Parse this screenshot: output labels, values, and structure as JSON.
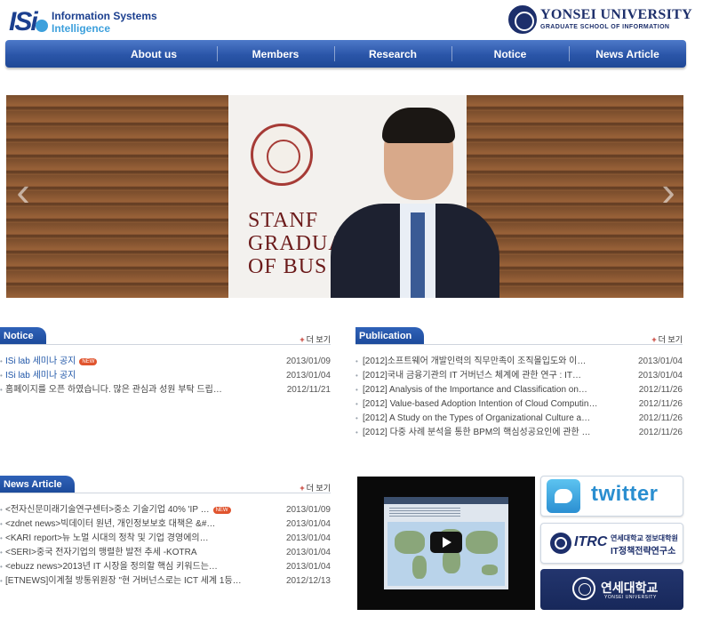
{
  "header": {
    "logo_mark": "ISi",
    "logo_line1": "Information Systems",
    "logo_line2": "Intelligence",
    "university_name": "YONSEI UNIVERSITY",
    "university_school": "GRADUATE SCHOOL OF INFORMATION"
  },
  "nav": {
    "items": [
      "About us",
      "Members",
      "Research",
      "Notice",
      "News Article"
    ]
  },
  "banner": {
    "sign_text_lines": [
      "STANF",
      "GRADUA",
      "OF BUS"
    ],
    "prev_glyph": "‹",
    "next_glyph": "›"
  },
  "notice": {
    "title": "Notice",
    "more_label": "더 보기",
    "items": [
      {
        "title": "ISi lab 세미나 공지",
        "date": "2013/01/09",
        "new": true,
        "new_label": "NEW"
      },
      {
        "title": "ISi lab 세미나 공지",
        "date": "2013/01/04",
        "new": false
      },
      {
        "title": "홈페이지를 오픈 하였습니다. 많은 관심과 성원 부탁 드립…",
        "date": "2012/11/21",
        "new": false
      }
    ]
  },
  "publication": {
    "title": "Publication",
    "more_label": "더 보기",
    "items": [
      {
        "title": "[2012]소프트웨어 개발인력의 직무만족이 조직몰입도와 이…",
        "date": "2013/01/04"
      },
      {
        "title": "[2012]국내 금융기관의 IT 거버넌스 체계에 관한 연구 : IT…",
        "date": "2013/01/04"
      },
      {
        "title": "[2012] Analysis of the Importance and Classification on…",
        "date": "2012/11/26"
      },
      {
        "title": "[2012] Value-based Adoption Intention of Cloud Computin…",
        "date": "2012/11/26"
      },
      {
        "title": "[2012] A Study on the Types of Organizational Culture a…",
        "date": "2012/11/26"
      },
      {
        "title": "[2012] 다중 사례 분석을 통한 BPM의 핵심성공요인에 관한 …",
        "date": "2012/11/26"
      }
    ]
  },
  "news": {
    "title": "News Article",
    "more_label": "더 보기",
    "items": [
      {
        "title": "<전자신문미래기술연구센터>중소 기술기업 40% 'IP …",
        "date": "2013/01/09",
        "new": true,
        "new_label": "NEW"
      },
      {
        "title": "<zdnet news>빅데이터 원년, 개인정보보호 대책은 &#…",
        "date": "2013/01/04",
        "new": false
      },
      {
        "title": "<KARI report>뉴 노멀 시대의 정착 및 기업 경영에의…",
        "date": "2013/01/04",
        "new": false
      },
      {
        "title": "<SERI>중국 전자기업의 맹렬한 발전 추세 -KOTRA",
        "date": "2013/01/04",
        "new": false
      },
      {
        "title": "<ebuzz news>2013년 IT 시장을 정의할 핵심 키워드는…",
        "date": "2013/01/04",
        "new": false
      },
      {
        "title": "[ETNEWS]이계철 방통위원장 \"현 거버넌스로는 ICT 세계 1등…",
        "date": "2012/12/13",
        "new": false
      }
    ]
  },
  "side": {
    "twitter_label": "twitter",
    "itrc_code": "ITRC",
    "itrc_line1": "연세대학교 정보대학원",
    "itrc_line2": "IT정책전략연구소",
    "yonsei_korean": "연세대학교",
    "yonsei_english": "YONSEI UNIVERSITY"
  }
}
